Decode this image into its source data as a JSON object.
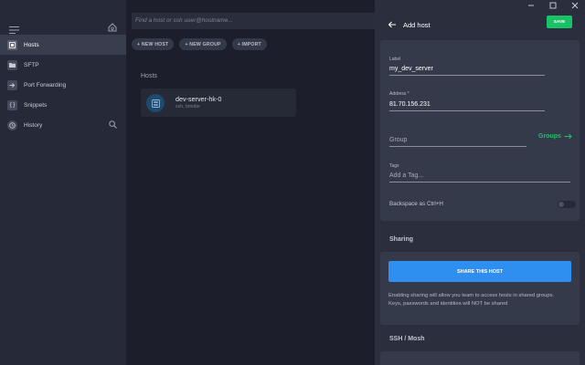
{
  "search": {
    "placeholder": "Find a host or ssh user@hostname..."
  },
  "sidebar": {
    "items": [
      {
        "label": "Hosts",
        "icon": "hosts-icon"
      },
      {
        "label": "SFTP",
        "icon": "folder-icon"
      },
      {
        "label": "Port Forwarding",
        "icon": "port-forwarding-icon"
      },
      {
        "label": "Snippets",
        "icon": "snippets-icon"
      },
      {
        "label": "History",
        "icon": "history-icon"
      }
    ]
  },
  "toolbar": {
    "new_host": "+ NEW HOST",
    "new_group": "+ NEW GROUP",
    "import": "+ IMPORT"
  },
  "hosts": {
    "section_title": "Hosts",
    "items": [
      {
        "name": "dev-server-hk-0",
        "subtitle": "ssh, bmobe"
      }
    ]
  },
  "panel": {
    "title": "Add host",
    "save": "SAVE",
    "label": {
      "caption": "Label",
      "value": "my_dev_server"
    },
    "address": {
      "caption": "Address *",
      "value": "81.70.156.231"
    },
    "group": {
      "placeholder": "Group",
      "link": "Groups"
    },
    "tags": {
      "caption": "Tags",
      "placeholder": "Add a Tag..."
    },
    "backspace": {
      "label": "Backspace as Ctrl+H",
      "enabled": false
    },
    "sharing": {
      "title": "Sharing",
      "button": "SHARE THIS HOST",
      "desc1": "Enabling sharing will allow you team to access hosts in shared groups.",
      "desc2": "Keys, passwords and identities will NOT be shared"
    },
    "ssh_title": "SSH / Mosh"
  },
  "colors": {
    "accent_green": "#19c267",
    "accent_blue": "#2f8ff0",
    "sidebar_bg": "#262a38",
    "panel_bg": "#2a2e3d"
  }
}
